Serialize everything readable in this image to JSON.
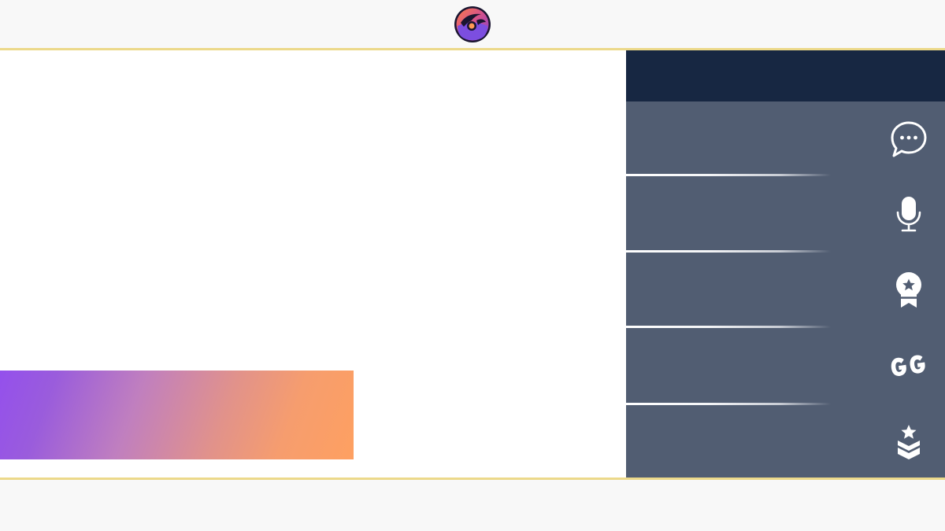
{
  "header": {
    "logo_icon": "game-logo-icon",
    "accent_line_color": "#ecd98a"
  },
  "main": {
    "banner": {
      "gradient_start": "#9450ec",
      "gradient_end": "#fea061"
    }
  },
  "sidebar": {
    "header_color": "#172742",
    "background_color": "#515d72",
    "items": [
      {
        "icon": "chat-bubble-icon"
      },
      {
        "icon": "microphone-icon"
      },
      {
        "icon": "award-badge-icon"
      },
      {
        "icon": "gg-icon"
      },
      {
        "icon": "rank-chevrons-icon"
      }
    ]
  }
}
